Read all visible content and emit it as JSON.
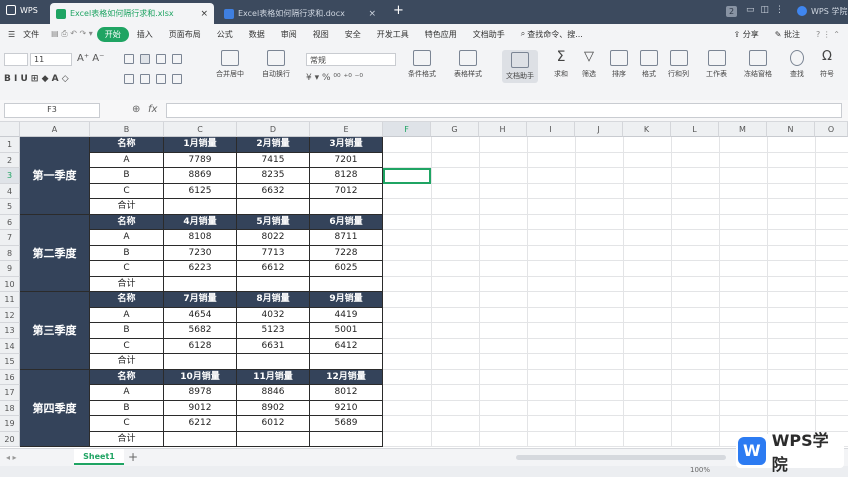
{
  "titlebar": {
    "app_label": "WPS",
    "tabs": [
      {
        "label": "Excel表格如何隔行求和.xlsx",
        "active": true
      },
      {
        "label": "Excel表格如何隔行求和.docx",
        "active": false
      }
    ],
    "new_tab": "+",
    "right_label": "WPS 学院",
    "badge": "2"
  },
  "menubar": {
    "file_label": "文件",
    "items": [
      "开始",
      "插入",
      "页面布局",
      "公式",
      "数据",
      "审阅",
      "视图",
      "安全",
      "开发工具",
      "特色应用",
      "文档助手"
    ],
    "active": "开始",
    "search_placeholder": "查找命令、搜...",
    "share": "分享",
    "annotate": "批注"
  },
  "ribbon": {
    "font_size": "11",
    "number_format": "常规",
    "buttons": [
      "合并居中",
      "自动换行",
      "条件格式",
      "表格样式",
      "文档助手",
      "求和",
      "筛选",
      "排序",
      "格式",
      "行和列",
      "工作表",
      "冻结窗格",
      "查找",
      "符号"
    ]
  },
  "formula_bar": {
    "cell_ref": "F3",
    "zoom_icon": "⊕",
    "fx": "fx",
    "value": ""
  },
  "columns": [
    "A",
    "B",
    "C",
    "D",
    "E",
    "F",
    "G",
    "H",
    "I",
    "J",
    "K",
    "L",
    "M",
    "N",
    "O"
  ],
  "rows": [
    "1",
    "2",
    "3",
    "4",
    "5",
    "6",
    "7",
    "8",
    "9",
    "10",
    "11",
    "12",
    "13",
    "14",
    "15",
    "16",
    "17",
    "18",
    "19",
    "20"
  ],
  "sheet": {
    "quarters": [
      {
        "name": "第一季度",
        "headers": [
          "名称",
          "1月销量",
          "2月销量",
          "3月销量"
        ],
        "rows": [
          [
            "A",
            "7789",
            "7415",
            "7201"
          ],
          [
            "B",
            "8869",
            "8235",
            "8128"
          ],
          [
            "C",
            "6125",
            "6632",
            "7012"
          ],
          [
            "合计",
            "",
            "",
            ""
          ]
        ]
      },
      {
        "name": "第二季度",
        "headers": [
          "名称",
          "4月销量",
          "5月销量",
          "6月销量"
        ],
        "rows": [
          [
            "A",
            "8108",
            "8022",
            "8711"
          ],
          [
            "B",
            "7230",
            "7713",
            "7228"
          ],
          [
            "C",
            "6223",
            "6612",
            "6025"
          ],
          [
            "合计",
            "",
            "",
            ""
          ]
        ]
      },
      {
        "name": "第三季度",
        "headers": [
          "名称",
          "7月销量",
          "8月销量",
          "9月销量"
        ],
        "rows": [
          [
            "A",
            "4654",
            "4032",
            "4419"
          ],
          [
            "B",
            "5682",
            "5123",
            "5001"
          ],
          [
            "C",
            "6128",
            "6631",
            "6412"
          ],
          [
            "合计",
            "",
            "",
            ""
          ]
        ]
      },
      {
        "name": "第四季度",
        "headers": [
          "名称",
          "10月销量",
          "11月销量",
          "12月销量"
        ],
        "rows": [
          [
            "A",
            "8978",
            "8846",
            "8012"
          ],
          [
            "B",
            "9012",
            "8902",
            "9210"
          ],
          [
            "C",
            "6212",
            "6012",
            "5689"
          ],
          [
            "合计",
            "",
            "",
            ""
          ]
        ]
      }
    ]
  },
  "sheetbar": {
    "sheet_tab": "Sheet1",
    "add": "+"
  },
  "statusbar": {
    "zoom": "100%"
  },
  "watermark": {
    "text": "WPS学院",
    "badge": "W"
  },
  "colors": {
    "header_bg": "#34435a",
    "accent_green": "#1fa463",
    "title_bg": "#3c4a5e"
  }
}
